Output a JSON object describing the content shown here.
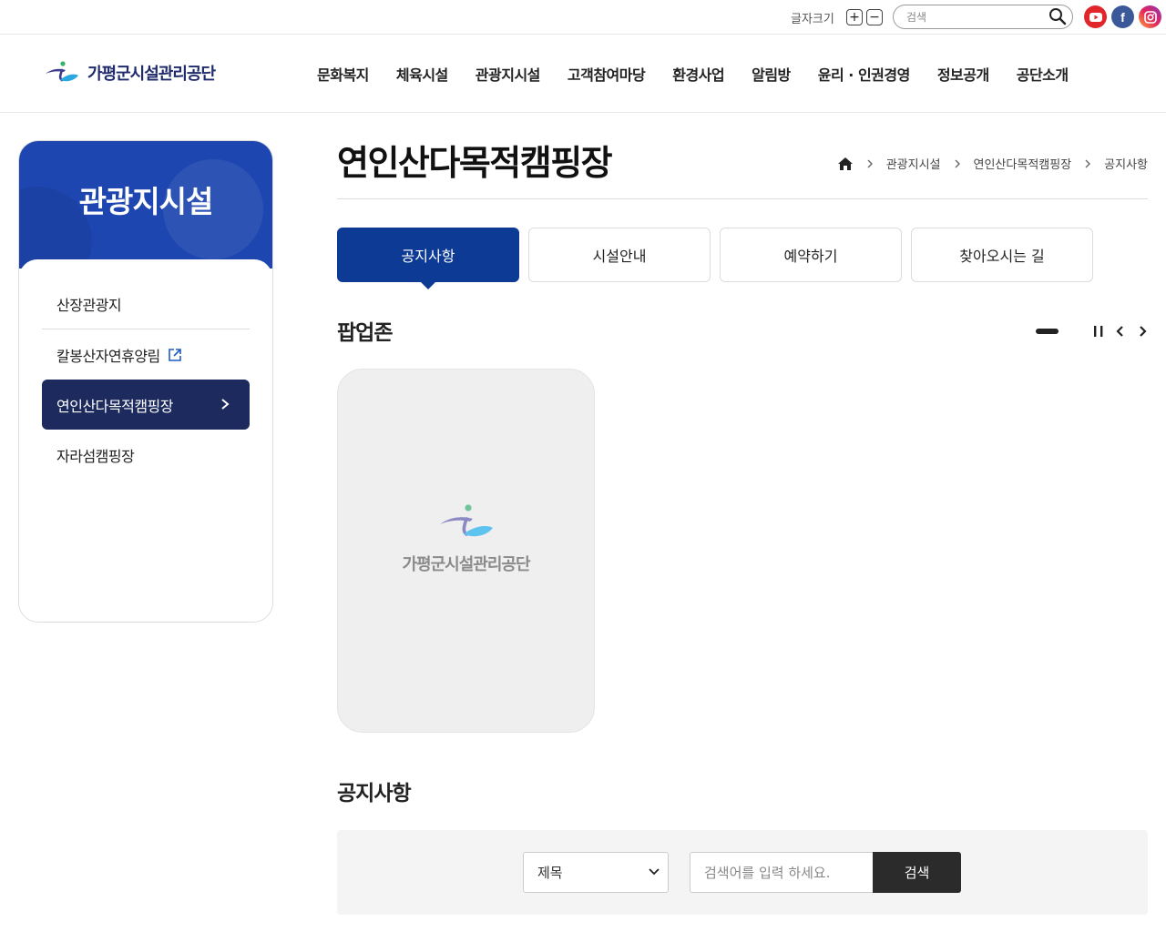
{
  "utility": {
    "font_size_label": "글자크기",
    "font_plus": "+",
    "font_minus": "−",
    "search_placeholder": "검색",
    "sns": [
      "youtube-icon",
      "facebook-icon",
      "instagram-icon"
    ],
    "facebook_glyph": "f"
  },
  "header": {
    "logo_text": "가평군시설관리공단",
    "nav": [
      "문화복지",
      "체육시설",
      "관광지시설",
      "고객참여마당",
      "환경사업",
      "알림방",
      "윤리 · 인권경영",
      "정보공개",
      "공단소개"
    ]
  },
  "lnb": {
    "title": "관광지시설",
    "items": [
      {
        "label": "산장관광지"
      },
      {
        "label": "칼봉산자연휴양림"
      },
      {
        "label": "연인산다목적캠핑장"
      },
      {
        "label": "자라섬캠핑장"
      }
    ],
    "active_index": 2
  },
  "content": {
    "page_title": "연인산다목적캠핑장",
    "breadcrumb": [
      "관광지시설",
      "연인산다목적캠핑장",
      "공지사항"
    ],
    "tabs": [
      "공지사항",
      "시설안내",
      "예약하기",
      "찾아오시는 길"
    ],
    "active_tab": 0,
    "popup_zone_title": "팝업존",
    "popup_card_text": "가평군시설관리공단",
    "notice_title": "공지사항",
    "search": {
      "select_value": "제목",
      "keyword_placeholder": "검색어를 입력 하세요.",
      "button_label": "검색"
    }
  },
  "colors": {
    "brand_blue": "#1e46b0",
    "active_tab": "#0c3a94",
    "lnb_active": "#1c2a5e",
    "search_button": "#2b2b2b"
  }
}
